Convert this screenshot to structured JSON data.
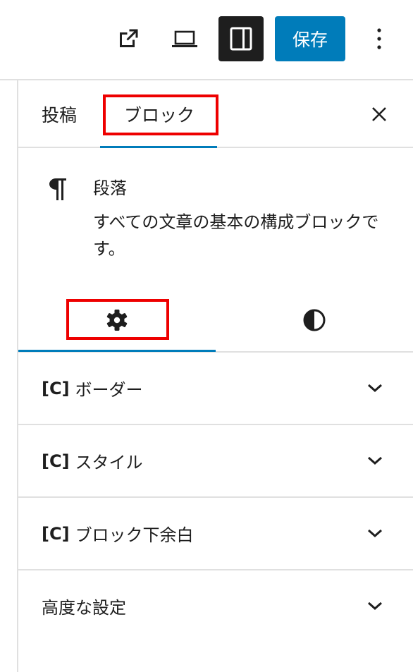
{
  "toolbar": {
    "external_icon": "external-link-icon",
    "preview_icon": "laptop-preview-icon",
    "settings_icon": "sidebar-panel-icon",
    "save_label": "保存",
    "more_icon": "vertical-ellipsis-icon"
  },
  "sidebar": {
    "tabs": [
      {
        "label": "投稿"
      },
      {
        "label": "ブロック"
      }
    ],
    "close_icon": "close-icon",
    "block": {
      "icon": "paragraph-icon",
      "title": "段落",
      "description": "すべての文章の基本の構成ブロックです。"
    },
    "sub_tabs": [
      {
        "icon": "gear-icon"
      },
      {
        "icon": "contrast-icon"
      }
    ],
    "panels": [
      {
        "tag": "[C]",
        "label": "ボーダー"
      },
      {
        "tag": "[C]",
        "label": "スタイル"
      },
      {
        "tag": "[C]",
        "label": "ブロック下余白"
      },
      {
        "tag": "",
        "label": "高度な設定"
      }
    ],
    "highlight_color": "#ee0000",
    "accent_color": "#007cba"
  }
}
